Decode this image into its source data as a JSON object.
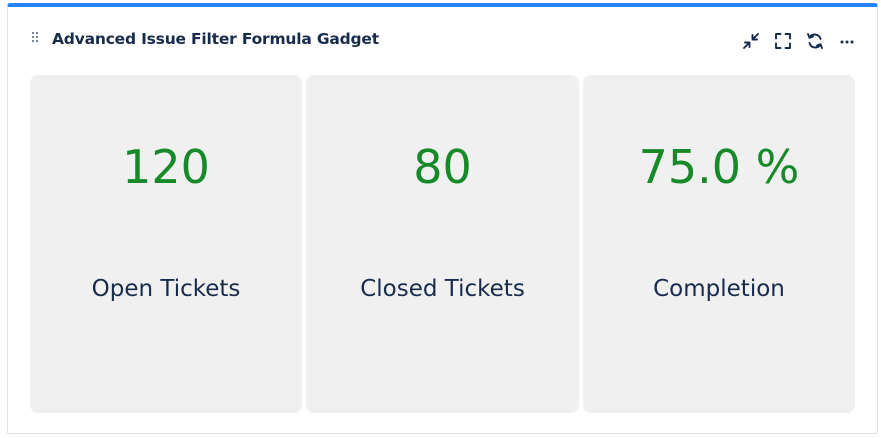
{
  "gadget": {
    "title": "Advanced Issue Filter Formula Gadget",
    "accent_color": "#2684ff",
    "actions": [
      {
        "icon": "minimize-icon"
      },
      {
        "icon": "fullscreen-icon"
      },
      {
        "icon": "refresh-icon"
      },
      {
        "icon": "more-icon"
      }
    ]
  },
  "cards": [
    {
      "value": "120",
      "label": "Open Tickets"
    },
    {
      "value": "80",
      "label": "Closed Tickets"
    },
    {
      "value": "75.0 %",
      "label": "Completion"
    }
  ],
  "colors": {
    "value_text": "#168a28",
    "card_background": "#f0f0f0",
    "label_text": "#172b4d"
  }
}
